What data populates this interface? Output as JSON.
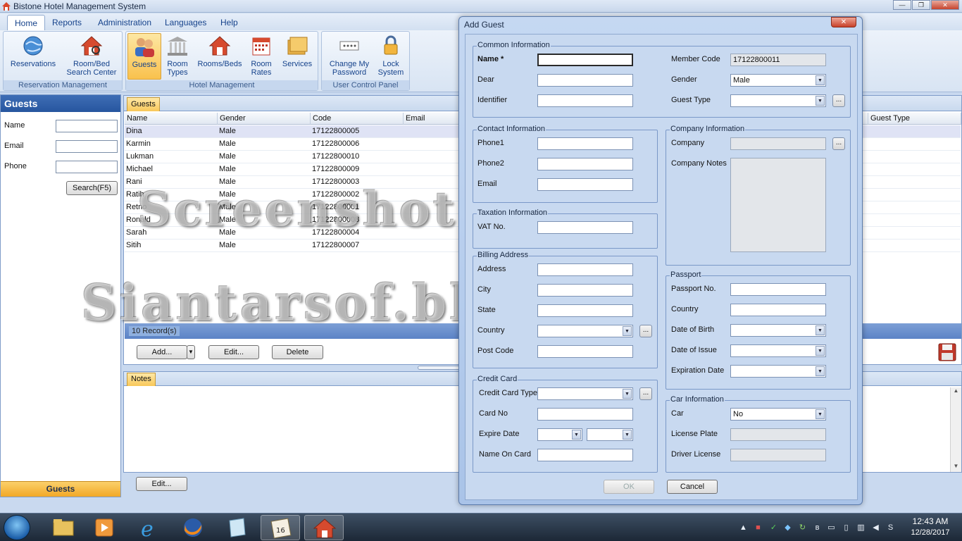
{
  "app": {
    "title": "Bistone Hotel Management System"
  },
  "menu": [
    "Home",
    "Reports",
    "Administration",
    "Languages",
    "Help"
  ],
  "ribbon": {
    "groups": [
      {
        "label": "Reservation Management",
        "buttons": [
          "Reservations",
          "Room/Bed Search Center"
        ]
      },
      {
        "label": "Hotel Management",
        "buttons": [
          "Guests",
          "Room Types",
          "Rooms/Beds",
          "Room Rates",
          "Services"
        ]
      },
      {
        "label": "User Control Panel",
        "buttons": [
          "Change My Password",
          "Lock System"
        ]
      }
    ]
  },
  "left_panel": {
    "title": "Guests",
    "fields": [
      "Name",
      "Email",
      "Phone"
    ],
    "search_button": "Search(F5)",
    "footer": "Guests"
  },
  "grid": {
    "tab": "Guests",
    "columns": [
      "Name",
      "Gender",
      "Code",
      "Email",
      "Guest Type"
    ],
    "rows": [
      [
        "Dina",
        "Male",
        "17122800005"
      ],
      [
        "Karmin",
        "Male",
        "17122800006"
      ],
      [
        "Lukman",
        "Male",
        "17122800010"
      ],
      [
        "Michael",
        "Male",
        "17122800009"
      ],
      [
        "Rani",
        "Male",
        "17122800003"
      ],
      [
        "Ratih",
        "Male",
        "17122800002"
      ],
      [
        "Retno",
        "Male",
        "17122800001"
      ],
      [
        "Ronald",
        "Male",
        "17122800008"
      ],
      [
        "Sarah",
        "Male",
        "17122800004"
      ],
      [
        "Sitih",
        "Male",
        "17122800007"
      ]
    ],
    "record_count": "10 Record(s)",
    "buttons": {
      "add": "Add...",
      "edit": "Edit...",
      "delete": "Delete"
    }
  },
  "notes": {
    "tab": "Notes",
    "edit_button": "Edit..."
  },
  "dialog": {
    "title": "Add Guest",
    "common": {
      "title": "Common Information",
      "name_label": "Name *",
      "dear_label": "Dear",
      "identifier_label": "Identifier",
      "member_code_label": "Member Code",
      "member_code_value": "17122800011",
      "gender_label": "Gender",
      "gender_value": "Male",
      "guest_type_label": "Guest Type"
    },
    "contact": {
      "title": "Contact Information",
      "phone1": "Phone1",
      "phone2": "Phone2",
      "email": "Email"
    },
    "company": {
      "title": "Company Information",
      "company": "Company",
      "notes": "Company Notes"
    },
    "taxation": {
      "title": "Taxation Information",
      "vat": "VAT No."
    },
    "billing": {
      "title": "Billing Address",
      "address": "Address",
      "city": "City",
      "state": "State",
      "country": "Country",
      "post_code": "Post Code"
    },
    "passport": {
      "title": "Passport",
      "passport_no": "Passport No.",
      "country": "Country",
      "dob": "Date of Birth",
      "issue": "Date of Issue",
      "expiry": "Expiration Date"
    },
    "credit_card": {
      "title": "Credit Card",
      "type": "Credit Card Type",
      "card_no": "Card No",
      "expire": "Expire Date",
      "name_on_card": "Name On Card"
    },
    "car": {
      "title": "Car Information",
      "car": "Car",
      "car_value": "No",
      "plate": "License Plate",
      "license": "Driver License"
    },
    "ok": "OK",
    "cancel": "Cancel"
  },
  "watermark": {
    "line1": "Screenshot ini milik",
    "line2": "Siantarsof.blogspot.com"
  },
  "taskbar": {
    "time": "12:43 AM",
    "date": "12/28/2017"
  },
  "colors": {
    "accent": "#27569f",
    "selected_tab": "#f8c85a",
    "dialog_bg": "#c8d9f0"
  }
}
